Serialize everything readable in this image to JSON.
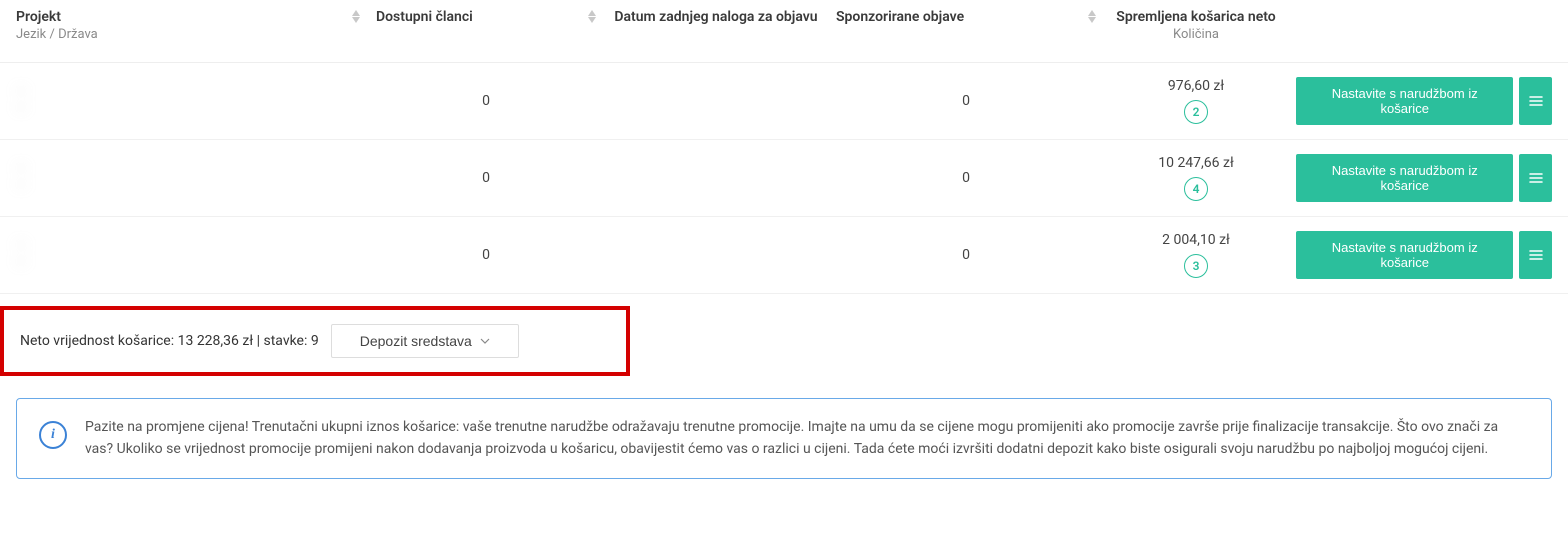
{
  "columns": {
    "project": {
      "label": "Projekt",
      "sub": "Jezik / Država"
    },
    "articles": {
      "label": "Dostupni članci"
    },
    "date": {
      "label": "Datum zadnjeg naloga za objavu"
    },
    "sponsored": {
      "label": "Sponzorirane objave"
    },
    "cart": {
      "label": "Spremljena košarica neto",
      "sub": "Količina"
    }
  },
  "rows": [
    {
      "project_line1": "—",
      "project_line2": "—",
      "articles": "0",
      "date": "",
      "sponsored": "0",
      "amount": "976,60 zł",
      "qty": "2"
    },
    {
      "project_line1": "—",
      "project_line2": "—",
      "articles": "0",
      "date": "",
      "sponsored": "0",
      "amount": "10 247,66 zł",
      "qty": "4"
    },
    {
      "project_line1": "—",
      "project_line2": "—",
      "articles": "0",
      "date": "",
      "sponsored": "0",
      "amount": "2 004,10 zł",
      "qty": "3"
    }
  ],
  "actions": {
    "continue": "Nastavite s narudžbom iz košarice"
  },
  "summary": {
    "net_label": "Neto vrijednost košarice:",
    "net_value": "13 228,36 zł",
    "items_label": "stavke:",
    "items_value": "9",
    "deposit": "Depozit sredstava"
  },
  "info": {
    "text": "Pazite na promjene cijena! Trenutačni ukupni iznos košarice: vaše trenutne narudžbe odražavaju trenutne promocije. Imajte na umu da se cijene mogu promijeniti ako promocije završe prije finalizacije transakcije. Što ovo znači za vas? Ukoliko se vrijednost promocije promijeni nakon dodavanja proizvoda u košaricu, obavijestit ćemo vas o razlici u cijeni. Tada ćete moći izvršiti dodatni depozit kako biste osigurali svoju narudžbu po najboljoj mogućoj cijeni."
  }
}
